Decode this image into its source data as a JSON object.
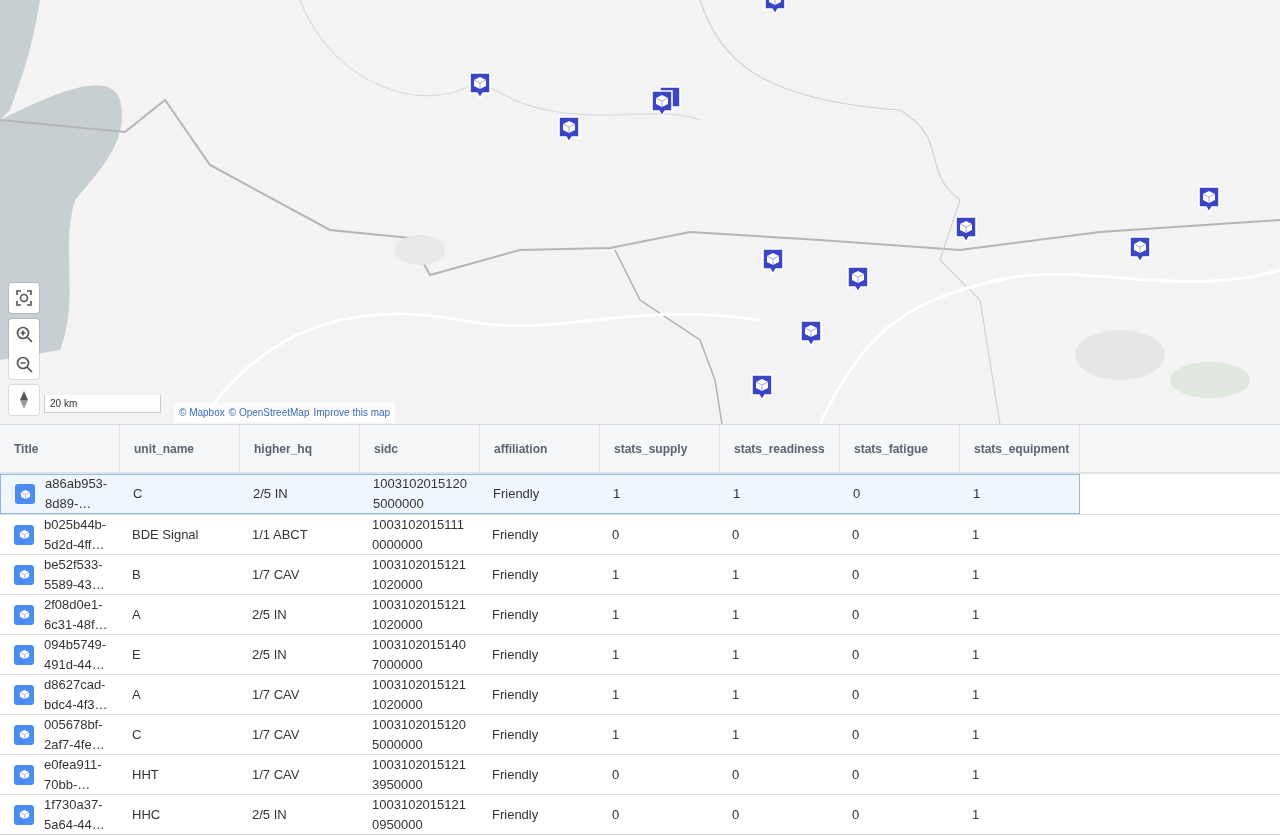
{
  "map": {
    "scale": "20 km",
    "attribution": [
      "© Mapbox",
      "© OpenStreetMap",
      "Improve this map"
    ]
  },
  "table": {
    "columns": [
      "Title",
      "unit_name",
      "higher_hq",
      "sidc",
      "affiliation",
      "stats_supply",
      "stats_readiness",
      "stats_fatigue",
      "stats_equipment"
    ],
    "rows": [
      {
        "selected": true,
        "cells": [
          "a86ab953-8d89-…",
          "C",
          "2/5 IN",
          "10031020151205000000",
          "Friendly",
          "1",
          "1",
          "0",
          "1"
        ]
      },
      {
        "selected": false,
        "cells": [
          "b025b44b-5d2d-4ff…",
          "BDE Signal",
          "1/1 ABCT",
          "10031020151110000000",
          "Friendly",
          "0",
          "0",
          "0",
          "1"
        ]
      },
      {
        "selected": false,
        "cells": [
          "be52f533-5589-43…",
          "B",
          "1/7 CAV",
          "10031020151211020000",
          "Friendly",
          "1",
          "1",
          "0",
          "1"
        ]
      },
      {
        "selected": false,
        "cells": [
          "2f08d0e1-6c31-48f…",
          "A",
          "2/5 IN",
          "10031020151211020000",
          "Friendly",
          "1",
          "1",
          "0",
          "1"
        ]
      },
      {
        "selected": false,
        "cells": [
          "094b5749-491d-44…",
          "E",
          "2/5 IN",
          "10031020151407000000",
          "Friendly",
          "1",
          "1",
          "0",
          "1"
        ]
      },
      {
        "selected": false,
        "cells": [
          "d8627cad-bdc4-4f3…",
          "A",
          "1/7 CAV",
          "10031020151211020000",
          "Friendly",
          "1",
          "1",
          "0",
          "1"
        ]
      },
      {
        "selected": false,
        "cells": [
          "005678bf-2af7-4fe…",
          "C",
          "1/7 CAV",
          "10031020151205000000",
          "Friendly",
          "1",
          "1",
          "0",
          "1"
        ]
      },
      {
        "selected": false,
        "cells": [
          "e0fea911-70bb-…",
          "HHT",
          "1/7 CAV",
          "10031020151213950000",
          "Friendly",
          "0",
          "0",
          "0",
          "1"
        ]
      },
      {
        "selected": false,
        "cells": [
          "1f730a37-5a64-44…",
          "HHC",
          "2/5 IN",
          "10031020151210950000",
          "Friendly",
          "0",
          "0",
          "0",
          "1"
        ]
      }
    ]
  }
}
